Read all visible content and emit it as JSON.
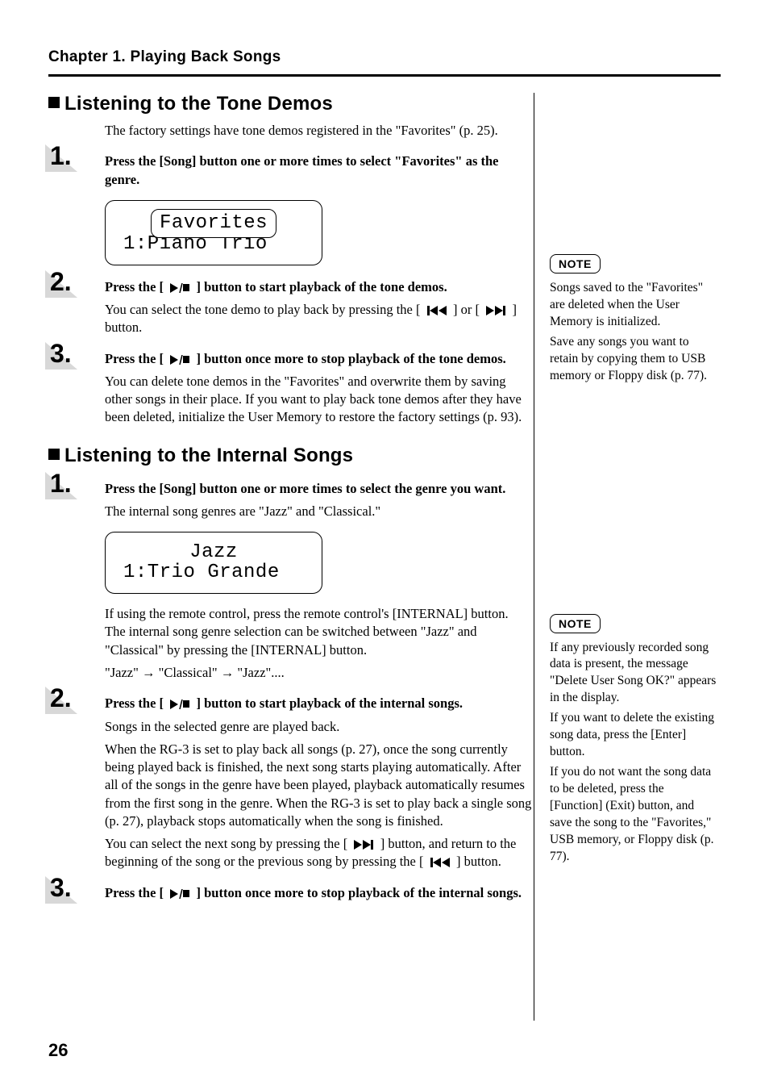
{
  "chapter_head": "Chapter 1. Playing Back Songs",
  "section_a": {
    "title": "Listening to the Tone Demos",
    "intro": "The factory settings have tone demos registered in the \"Favorites\" (p. 25).",
    "steps": [
      {
        "n": "1.",
        "instr": "Press the [Song] button one or more times to select \"Favorites\" as the genre.",
        "lcd": {
          "line1_boxed": "Favorites",
          "line2": "1:Piano Trio"
        }
      },
      {
        "n": "2.",
        "instr_pre": "Press the [ ",
        "instr_post": " ] button to start playback of the tone demos.",
        "para_pre": "You can select the tone demo to play back by pressing the [ ",
        "para_mid": " ] or [ ",
        "para_post": " ] button."
      },
      {
        "n": "3.",
        "instr_pre": "Press the [ ",
        "instr_post": " ] button once more to stop playback of the tone demos.",
        "para": "You can delete tone demos in the \"Favorites\" and overwrite them by saving other songs in their place. If you want to play back tone demos after they have been deleted, initialize the User Memory to restore the factory settings (p. 93)."
      }
    ]
  },
  "section_b": {
    "title": "Listening to the Internal Songs",
    "steps": [
      {
        "n": "1.",
        "instr": "Press the [Song] button one or more times to select the genre you want.",
        "para": "The internal song genres are \"Jazz\" and \"Classical.\"",
        "lcd": {
          "line1": "Jazz",
          "line2": "1:Trio Grande"
        },
        "para2": "If using the remote control, press the remote control's [INTERNAL] button. The internal song genre selection can be switched between \"Jazz\" and \"Classical\" by pressing the [INTERNAL] button.",
        "para3": "\"Jazz\" → \"Classical\" → \"Jazz\"...."
      },
      {
        "n": "2.",
        "instr_pre": "Press the [ ",
        "instr_post": " ] button to start playback of the internal songs.",
        "para": "Songs in the selected genre are played back.",
        "para2": "When the RG-3 is set to play back all songs (p. 27), once the song currently being played back is finished, the next song starts playing automatically. After all of the songs in the genre have been played, playback automatically resumes from the first song in the genre. When the RG-3 is set to play back a single song (p. 27), playback stops automatically when the song is finished.",
        "para3_pre": "You can select the next song by pressing the [ ",
        "para3_mid": " ] button, and return to the beginning of the song or the previous song by pressing the [ ",
        "para3_post": " ] button."
      },
      {
        "n": "3.",
        "instr_pre": "Press the [ ",
        "instr_post": " ] button once more to stop playback of the internal songs."
      }
    ]
  },
  "sidebar": {
    "note_label": "NOTE",
    "note1": {
      "p1": "Songs saved to the \"Favorites\" are deleted when the User Memory is initialized.",
      "p2": "Save any songs you want to retain by copying them to USB memory or Floppy disk (p. 77)."
    },
    "note2": {
      "p1": "If any previously recorded song data is present, the message \"Delete User Song OK?\" appears in the display.",
      "p2": "If you want to delete the existing song data, press the [Enter] button.",
      "p3": "If you do not want the song data to be deleted, press the [Function] (Exit) button, and save the song to the \"Favorites,\" USB memory, or Floppy disk (p. 77)."
    }
  },
  "page_number": "26"
}
